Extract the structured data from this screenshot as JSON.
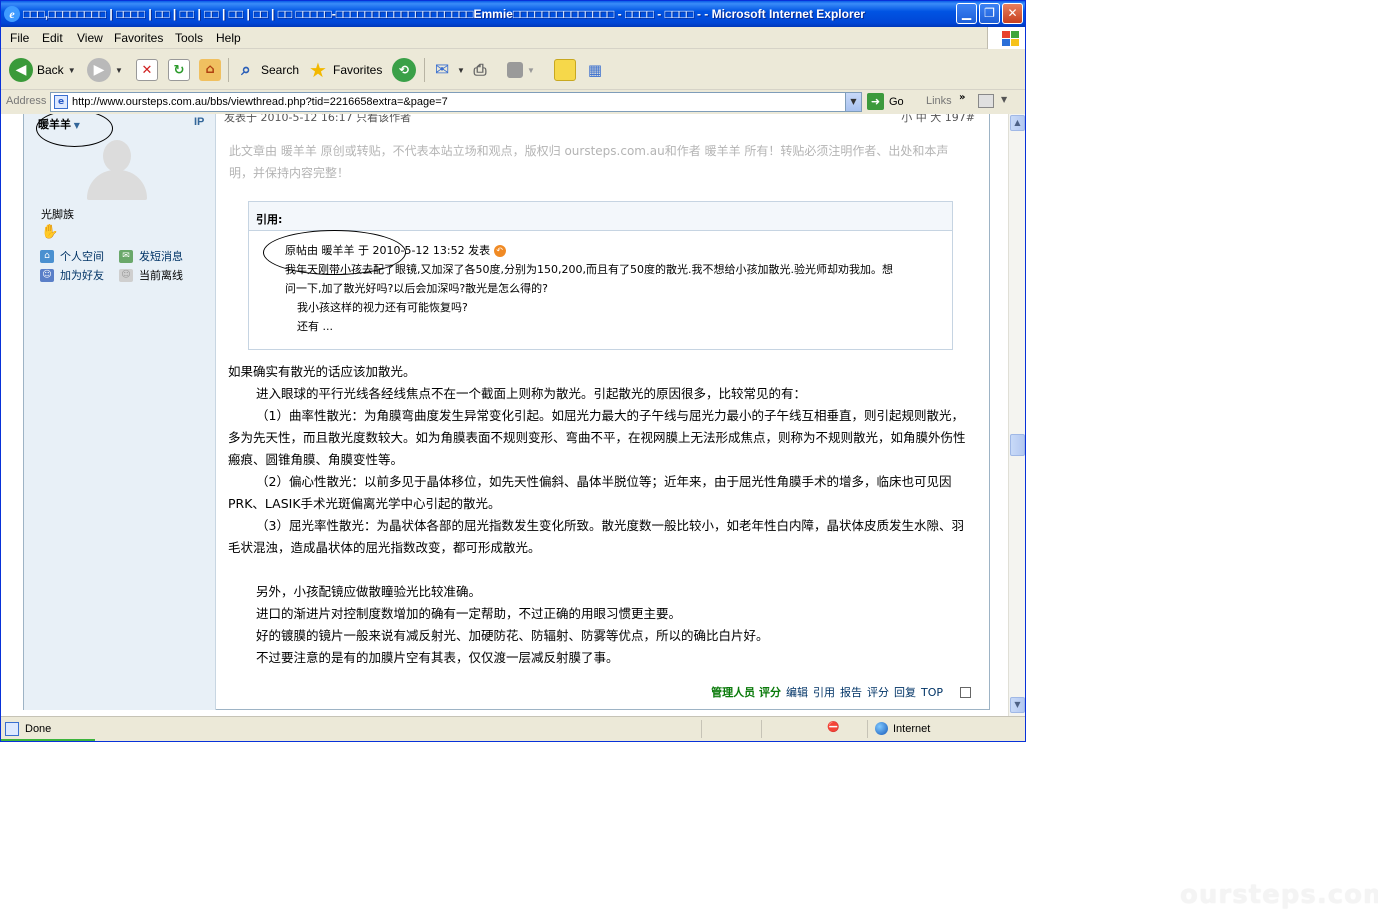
{
  "window": {
    "title": "□□□,□□□□□□□□ | □□□□ | □□ | □□ | □□ | □□ | □□ | □□ □□□□□-□□□□□□□□□□□□□□□□□□□Emmie□□□□□□□□□□□□□□ - □□□□ - □□□□ - - Microsoft Internet Explorer",
    "minimize_glyph": "▁",
    "restore_glyph": "❐",
    "close_glyph": "✕"
  },
  "menu": [
    "File",
    "Edit",
    "View",
    "Favorites",
    "Tools",
    "Help"
  ],
  "toolbar": {
    "back_label": "Back",
    "search_label": "Search",
    "favorites_label": "Favorites"
  },
  "address": {
    "label": "Address",
    "url": "http://www.oursteps.com.au/bbs/viewthread.php?tid=2216658extra=&page=7",
    "go_label": "Go",
    "links_label": "Links"
  },
  "post": {
    "author": "暖羊羊",
    "ip_label": "IP",
    "meta": "发表于 2010-5-12 16:17  只看该作者",
    "font_size_controls": "小 中 大  197#",
    "usergroup": "光脚族",
    "rank_icon": "footprint-icon",
    "links": {
      "space": "个人空间",
      "message": "发短消息",
      "add_friend": "加为好友",
      "status": "当前离线"
    },
    "copyright_note": "此文章由 暖羊羊 原创或转贴，不代表本站立场和观点，版权归 oursteps.com.au和作者 暖羊羊 所有！转贴必须注明作者、出处和本声明，并保持内容完整！",
    "quote": {
      "heading": "引用:",
      "line1": "原帖由 暖羊羊 于 2010-5-12 13:52 发表",
      "line2": "我年天刚带小孩去配了眼镜,又加深了各50度,分别为150,200,而且有了50度的散光.我不想给小孩加散光.验光师却劝我加。想",
      "line3": "问一下,加了散光好吗?以后会加深吗?散光是怎么得的?",
      "line4": "我小孩这样的视力还有可能恢复吗?",
      "line5": "还有 ..."
    },
    "body": {
      "p1": "如果确实有散光的话应该加散光。",
      "p2": "进入眼球的平行光线各经线焦点不在一个截面上则称为散光。引起散光的原因很多，比较常见的有：",
      "p3": "（1）曲率性散光：为角膜弯曲度发生异常变化引起。如屈光力最大的子午线与屈光力最小的子午线互相垂直，则引起规则散光，多为先天性，而且散光度数较大。如为角膜表面不规则变形、弯曲不平，在视网膜上无法形成焦点，则称为不规则散光，如角膜外伤性瘢痕、圆锥角膜、角膜变性等。",
      "p4": "（2）偏心性散光：以前多见于晶体移位，如先天性偏斜、晶体半脱位等；近年来，由于屈光性角膜手术的增多，临床也可见因PRK、LASIK手术光斑偏离光学中心引起的散光。",
      "p5": "（3）屈光率性散光：为晶状体各部的屈光指数发生变化所致。散光度数一般比较小，如老年性白内障，晶状体皮质发生水隙、羽毛状混浊，造成晶状体的屈光指数改变，都可形成散光。",
      "p6": "另外，小孩配镜应做散瞳验光比较准确。",
      "p7": "进口的渐进片对控制度数增加的确有一定帮助，不过正确的用眼习惯更主要。",
      "p8": "好的镀膜的镜片一般来说有减反射光、加硬防花、防辐射、防雾等优点，所以的确比白片好。",
      "p9": "不过要注意的是有的加膜片空有其表，仅仅渡一层减反射膜了事。"
    },
    "actions": {
      "admin_rate": "管理人员 评分",
      "edit": "编辑",
      "quote": "引用",
      "report": "报告",
      "rate": "评分",
      "reply": "回复",
      "top": "TOP"
    }
  },
  "status": {
    "text": "Done",
    "zone": "Internet"
  },
  "watermark": "oursteps.com.au"
}
